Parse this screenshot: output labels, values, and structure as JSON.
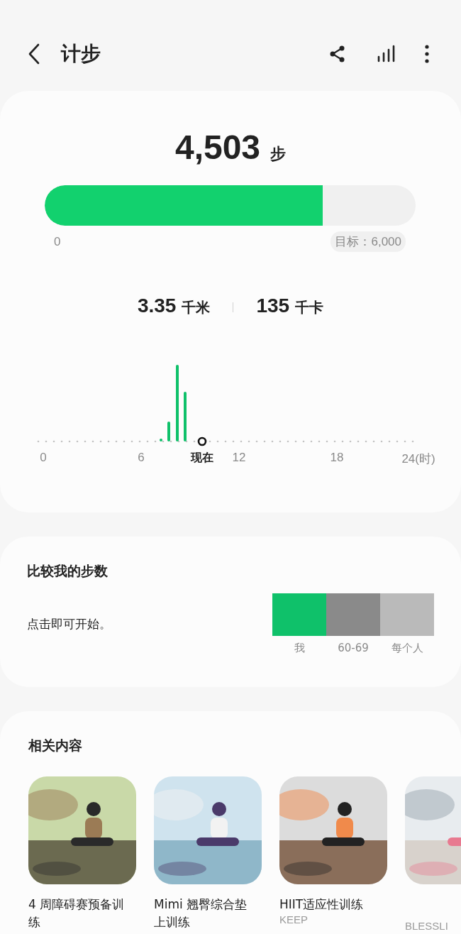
{
  "header": {
    "title": "计步"
  },
  "summary": {
    "steps": "4,503",
    "steps_unit": "步",
    "level": 0.75,
    "min_label": "0",
    "goal_label": "目标：6,000",
    "distance": "3.35",
    "distance_unit": "千米",
    "calories": "135",
    "calories_unit": "千卡"
  },
  "activity": {
    "axis_labels": [
      "0",
      "6",
      "现在",
      "12",
      "18",
      "24(时)"
    ]
  },
  "compare": {
    "title": "比较我的步数",
    "prompt": "点击即可开始。",
    "segments": [
      {
        "label": "我",
        "color": "#0fc16a"
      },
      {
        "label": "60-69",
        "color": "#8a8a8a"
      },
      {
        "label": "每个人",
        "color": "#bababa"
      }
    ]
  },
  "related": {
    "title": "相关内容",
    "items": [
      {
        "title": "4 周障碍赛预备训练",
        "kind": "picture"
      },
      {
        "title": "Mimi 翘臀综合垫上训练",
        "kind": "picture"
      },
      {
        "title": "HIIT适应性训练",
        "source": "KEEP",
        "kind": "picture"
      },
      {
        "source": "BLESSLI",
        "kind": "picture"
      }
    ]
  }
}
